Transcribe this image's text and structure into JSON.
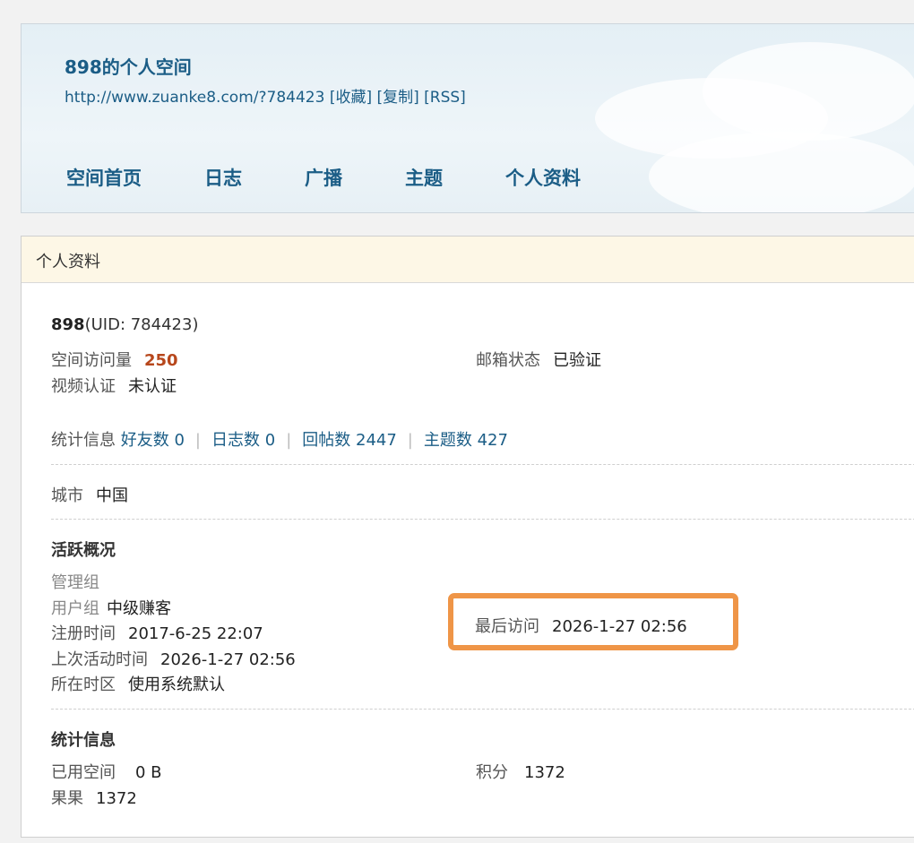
{
  "header": {
    "title": "898的个人空间",
    "url": "http://www.zuanke8.com/?784423",
    "actions": [
      "[收藏]",
      "[复制]",
      "[RSS]"
    ]
  },
  "nav": [
    "空间首页",
    "日志",
    "广播",
    "主题",
    "个人资料"
  ],
  "panel": {
    "title": "个人资料",
    "username": "898",
    "uid": "(UID: 784423)",
    "visits_label": "空间访问量",
    "visits_value": "250",
    "email_label": "邮箱状态",
    "email_value": "已验证",
    "video_label": "视频认证",
    "video_value": "未认证",
    "stats": {
      "label": "统计信息",
      "friends": "好友数 0",
      "blogs": "日志数 0",
      "replies": "回帖数 2447",
      "threads": "主题数 427"
    },
    "city_label": "城市",
    "city_value": "中国",
    "activity": {
      "title": "活跃概况",
      "admin_group_label": "管理组",
      "user_group_label": "用户组",
      "user_group_value": "中级赚客",
      "register_label": "注册时间",
      "register_value": "2017-6-25 22:07",
      "last_active_label": "上次活动时间",
      "last_active_value": "2026-1-27 02:56",
      "timezone_label": "所在时区",
      "timezone_value": "使用系统默认",
      "last_visit_label": "最后访问",
      "last_visit_value": "2026-1-27 02:56"
    },
    "statistics": {
      "title": "统计信息",
      "space_label": "已用空间",
      "space_value": "0 B",
      "points_label": "积分",
      "points_value": "1372",
      "fruit_label": "果果",
      "fruit_value": "1372"
    }
  },
  "colors": {
    "link": "#1b5d86",
    "accent_number": "#b7471c",
    "highlight_border": "#ef9547",
    "panel_header_bg": "#fdf7e6"
  }
}
